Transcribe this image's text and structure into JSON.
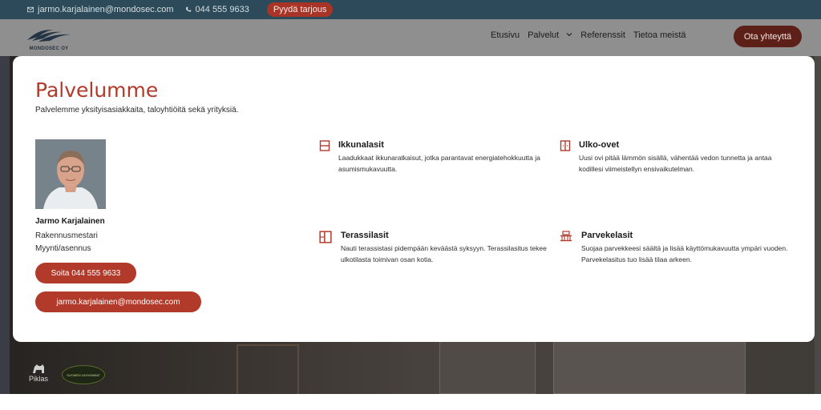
{
  "topbar": {
    "email": "jarmo.karjalainen@mondosec.com",
    "phone": "044 555 9633",
    "cta": "Pyydä tarjous"
  },
  "header": {
    "logo_text": "MONDOSEC OY",
    "nav": [
      "Etusivu",
      "Palvelut",
      "Referenssit",
      "Tietoa meistä"
    ],
    "contact_button": "Ota yhteyttä"
  },
  "modal": {
    "title": "Palvelumme",
    "subtitle": "Palvelemme yksityisasiakkaita, taloyhtiöitä sekä yrityksiä.",
    "contact": {
      "name": "Jarmo Karjalainen",
      "role1": "Rakennusmestari",
      "role2": "Myynti/asennus",
      "call_button": "Soita 044 555 9633",
      "email_button": "jarmo.karjalainen@mondosec.com"
    },
    "services": [
      {
        "title": "Ikkunalasit",
        "icon": "window-icon",
        "description": "Laadukkaat ikkunaratkaisut, jotka parantavat energiatehokkuutta ja asumismukavuutta."
      },
      {
        "title": "Ulko-ovet",
        "icon": "door-icon",
        "description": "Uusi ovi pitää lämmön sisällä, vähentää vedon tunnetta ja antaa kodillesi viimeistellyn ensivaikutelman."
      },
      {
        "title": "Terassilasit",
        "icon": "terrace-glass-icon",
        "description": "Nauti terassistasi pidempään keväästä syksyyn. Terassilasitus tekee ulkotilasta toimivan osan kotia."
      },
      {
        "title": "Parvekelasit",
        "icon": "balcony-icon",
        "description": "Suojaa parvekkeesi säältä ja lisää käyttömukavuutta ympäri vuoden. Parvekelasitus tuo lisää tilaa arkeen."
      }
    ]
  },
  "footer": {
    "piklas": "Piklas",
    "badge": "SUOMEN VAHVIMMAT"
  },
  "colors": {
    "accent": "#b23a2b",
    "topbar": "#2c4a59"
  }
}
